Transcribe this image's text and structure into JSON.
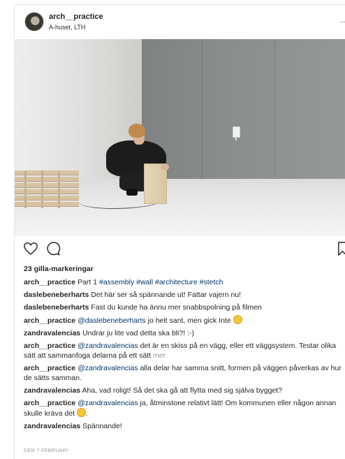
{
  "post": {
    "username": "arch__practice",
    "location": "A-huset, LTH",
    "more_label": "...",
    "likes_text": "23 gilla-markeringar",
    "date": "DEN 7 FEBRUARI",
    "icons": [
      "heart-icon",
      "comment-icon",
      "bookmark-icon",
      "chevron-right-icon"
    ]
  },
  "caption": {
    "user": "arch__practice",
    "text": "Part 1",
    "tags": [
      "#assembly",
      "#wall",
      "#architecture",
      "#stetch"
    ]
  },
  "comments": [
    {
      "user": "daslebeneberharts",
      "text": "Det här ser så spännande ut! Fattar vajern nu!"
    },
    {
      "user": "daslebeneberharts",
      "text": "Fast du kunde ha ännu mer snabbspolning på filmen"
    },
    {
      "user": "arch__practice",
      "mention": "@daslebeneberharts",
      "text": "jo helt sant, men gick Inte",
      "emoji": "grimace-emoji"
    },
    {
      "user": "zandravalencias",
      "text": "Undrar ju lite vad detta ska bli?! :-)"
    },
    {
      "user": "arch__practice",
      "mention": "@zandravalencias",
      "text": "det är en skiss på en vägg, eller ett väggsystem. Testar olika sätt att sammanfoga delarna på ett sätt",
      "more": "mer"
    },
    {
      "user": "arch__practice",
      "mention": "@zandravalencias",
      "text": "alla delar har samma snitt, formen på väggen påverkas av hur de sätts samman."
    },
    {
      "user": "zandravalencias",
      "text": "Aha, vad roligt! Så det ska gå att flytta med sig själva bygget?"
    },
    {
      "user": "arch__practice",
      "mention": "@zandravalencias",
      "text": "ja, åtminstone relativt lätt! Om kommunen eller någon annan skulle kräva det",
      "emoji": "grin-emoji",
      "suffix": "."
    },
    {
      "user": "zandravalencias",
      "text": "Spännande!"
    }
  ]
}
